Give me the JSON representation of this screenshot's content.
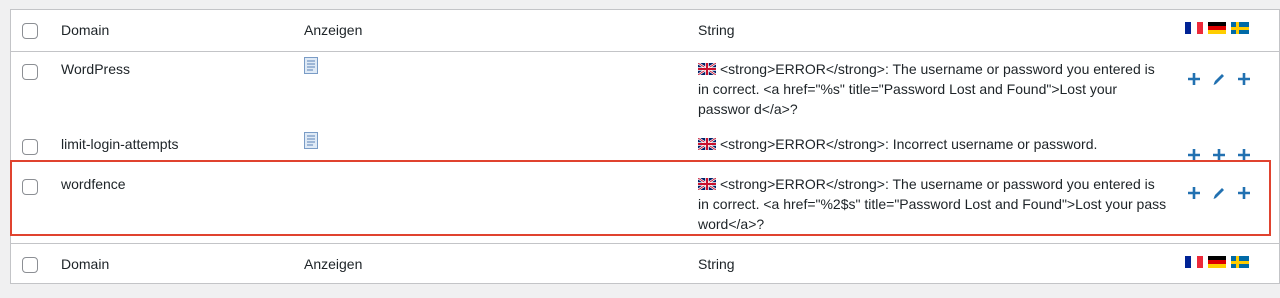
{
  "header": {
    "domain": "Domain",
    "show": "Anzeigen",
    "string": "String",
    "flags": [
      "flag-fr-icon",
      "flag-de-icon",
      "flag-se-icon"
    ]
  },
  "rows": [
    {
      "domain": "WordPress",
      "has_doc_icon": true,
      "string": "<strong>ERROR</strong>: The username or password you entered is in correct. <a href=\"%s\" title=\"Password Lost and Found\">Lost your passwor d</a>?",
      "actions": [
        "add",
        "edit",
        "add"
      ]
    },
    {
      "domain": "limit-login-attempts",
      "has_doc_icon": true,
      "string": "<strong>ERROR</strong>: Incorrect username or password.",
      "actions": [
        "add",
        "add",
        "add"
      ]
    },
    {
      "domain": "wordfence",
      "has_doc_icon": false,
      "string": "<strong>ERROR</strong>: The username or password you entered is in correct. <a href=\"%2$s\" title=\"Password Lost and Found\">Lost your pass word</a>?",
      "actions": [
        "add",
        "edit",
        "add"
      ],
      "highlighted": true
    }
  ],
  "footer": {
    "domain": "Domain",
    "show": "Anzeigen",
    "string": "String"
  },
  "colors": {
    "action": "#2271b1",
    "highlight": "#e0432f"
  }
}
